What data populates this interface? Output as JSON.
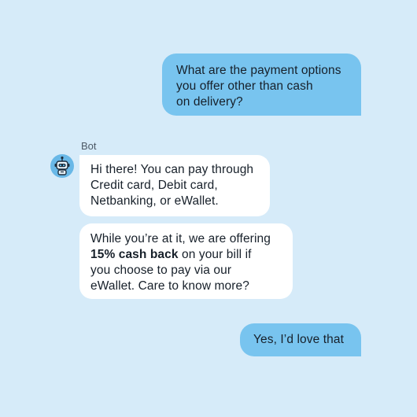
{
  "user_messages": [
    {
      "text": "What are the payment options\nyou offer other than cash\non delivery?"
    },
    {
      "text": "Yes, I’d love that"
    }
  ],
  "bot": {
    "name": "Bot",
    "avatar_icon": "robot-icon",
    "messages": [
      {
        "text": "Hi there! You can pay through\nCredit card, Debit card,\nNetbanking, or eWallet."
      },
      {
        "text_before": "While you’re at it, we are offering\n",
        "text_bold": "15% cash back",
        "text_after": " on your bill if\nyou choose to pay via our\neWallet. Care to know more?"
      }
    ]
  },
  "colors": {
    "background": "#d6ebf9",
    "user_bubble": "#78c4ef",
    "bot_bubble": "#ffffff",
    "avatar": "#69b8e7"
  }
}
